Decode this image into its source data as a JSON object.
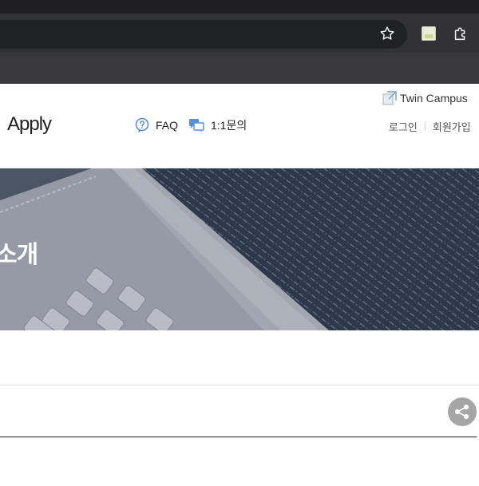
{
  "header": {
    "twin_campus": "Twin Campus",
    "brand": "Apply",
    "faq_label": "FAQ",
    "inquiry_label": "1:1문의",
    "login_label": "로그인",
    "signup_label": "회원가입"
  },
  "hero": {
    "title": "소개"
  },
  "icons": {
    "star": "star-icon",
    "puzzle": "puzzle-icon",
    "faq": "question-circle-icon",
    "inquiry": "chat-bubbles-icon",
    "share": "share-icon",
    "twin_campus": "twin-campus-icon"
  },
  "colors": {
    "accent_blue": "#5a8fd6",
    "share_bg": "#a6a6a6",
    "hero_bg": "#5f6775"
  }
}
